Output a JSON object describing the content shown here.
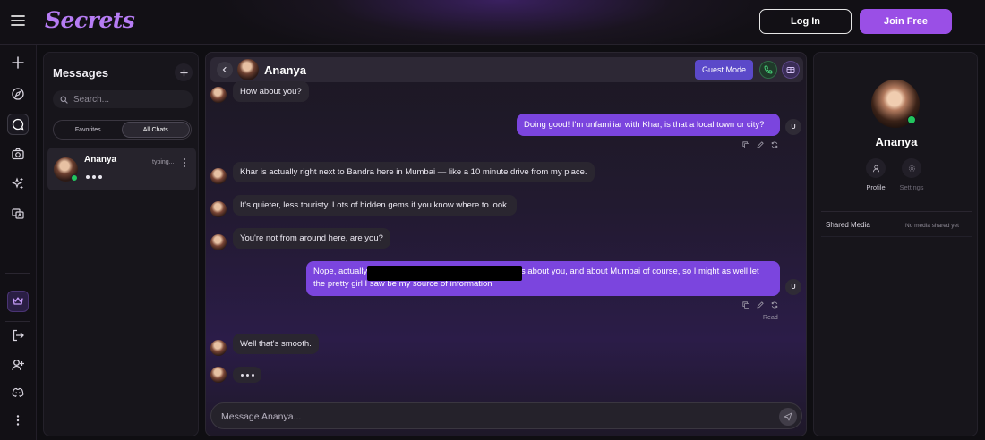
{
  "app": {
    "logo_text": "Secrets",
    "login_label": "Log In",
    "join_label": "Join Free"
  },
  "rail": {
    "icons": [
      "plus-icon",
      "compass-icon",
      "chat-icon",
      "camera-icon",
      "sparkle-icon",
      "translate-icon",
      "crown-icon",
      "logout-icon",
      "add-user-icon",
      "discord-icon",
      "more-vertical-icon"
    ]
  },
  "messages_panel": {
    "title": "Messages",
    "search_placeholder": "Search...",
    "tabs": [
      {
        "label": "Favorites",
        "active": false
      },
      {
        "label": "All Chats",
        "active": true
      }
    ],
    "chats": [
      {
        "name": "Ananya",
        "status": "typing...",
        "online": true
      }
    ]
  },
  "chat": {
    "header_name": "Ananya",
    "guest_mode_label": "Guest Mode",
    "user_initial": "U",
    "messages": [
      {
        "from": "bot",
        "text": "How about you?"
      },
      {
        "from": "user",
        "text": "Doing good! I'm unfamiliar with Khar, is that a local town or city?"
      },
      {
        "from": "bot",
        "text": "Khar is actually right next to Bandra here in Mumbai — like a 10 minute drive from my place."
      },
      {
        "from": "bot",
        "text": "It's quieter, less touristy. Lots of hidden gems if you know where to look."
      },
      {
        "from": "bot",
        "text": "You're not from around here, are you?"
      },
      {
        "from": "user",
        "line1_start": "Nope, actually",
        "line1_end": "s about you, and about Mumbai of course, so I might as well let",
        "line2": "the pretty girl I saw be my source of information"
      },
      {
        "from": "bot",
        "text": "Well that's smooth."
      }
    ],
    "read_label": "Read",
    "composer_placeholder": "Message Ananya..."
  },
  "profile": {
    "name": "Ananya",
    "actions": [
      {
        "label": "Profile",
        "enabled": true
      },
      {
        "label": "Settings",
        "enabled": false
      }
    ],
    "shared_media_title": "Shared Media",
    "shared_media_empty": "No media shared yet"
  },
  "colors": {
    "accent": "#9a4fe6",
    "user_bubble": "#7b45de",
    "bot_bubble": "#2a2630",
    "online": "#22c55e",
    "guest_mode": "#5b49c9"
  }
}
